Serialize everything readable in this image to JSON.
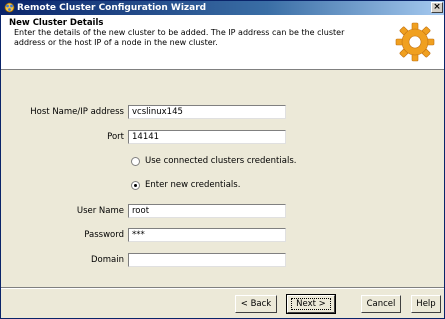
{
  "window": {
    "title": "Remote Cluster Configuration Wizard",
    "close_glyph": "×"
  },
  "header": {
    "title": "New Cluster Details",
    "description": "Enter the details of the new cluster to be added. The IP address can be the cluster address or the host IP of a node in the new cluster.",
    "icon": "gear-icon"
  },
  "form": {
    "host_label": "Host Name/IP address",
    "host_value": "vcslinux145",
    "port_label": "Port",
    "port_value": "14141",
    "radio_connected_label": "Use connected clusters credentials.",
    "radio_connected_selected": false,
    "radio_new_label": "Enter new credentials.",
    "radio_new_selected": true,
    "username_label": "User Name",
    "username_value": "root",
    "password_label": "Password",
    "password_value": "***",
    "domain_label": "Domain",
    "domain_value": ""
  },
  "footer": {
    "back_label": "< Back",
    "next_label": "Next >",
    "cancel_label": "Cancel",
    "help_label": "Help"
  },
  "colors": {
    "titlebar_start": "#0a246a",
    "titlebar_end": "#a6caf0",
    "dialog_bg": "#ece9d8",
    "gear_orange": "#f0a020"
  }
}
